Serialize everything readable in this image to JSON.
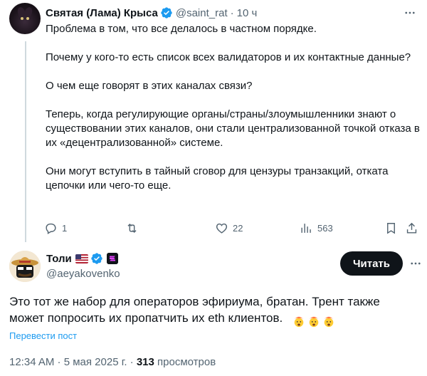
{
  "reply_tweet": {
    "display_name": "Святая (Лама) Крыса",
    "handle": "@saint_rat",
    "separator": "·",
    "time": "10 ч",
    "paragraphs": [
      "Проблема в том, что все делалось в частном порядке.",
      "Почему у кого-то есть список всех валидаторов и их контактные данные?",
      "О чем еще говорят в этих каналах связи?",
      "Теперь, когда регулирующие органы/страны/злоумышленники знают о существовании этих каналов, они стали централизованной точкой отказа в их «децентрализованной» системе.",
      "Они могут вступить в тайный сговор для цензуры транзакций, отката цепочки или чего-то еще."
    ],
    "actions": {
      "replies": "1",
      "retweets": "",
      "likes": "22",
      "views": "563"
    }
  },
  "main_tweet": {
    "display_name": "Толи",
    "handle": "@aeyakovenko",
    "follow_label": "Читать",
    "text": "Это тот же набор для операторов эфириума, братан.  Трент также может попросить их пропатчить их eth клиентов.",
    "translate_label": "Перевести пост",
    "timestamp": "12:34 AM · 5 мая 2025 г. · ",
    "views_count": "313",
    "views_label": " просмотров"
  },
  "colors": {
    "accent": "#1d9bf0",
    "text": "#0f1419",
    "secondary": "#536471",
    "button_bg": "#0f1419"
  },
  "icons": [
    "reply-icon",
    "retweet-icon",
    "like-icon",
    "views-icon",
    "bookmark-icon",
    "share-icon",
    "more-icon",
    "verified-badge-icon",
    "us-flag-icon",
    "affiliate-badge-icon",
    "exploding-head-emoji"
  ]
}
